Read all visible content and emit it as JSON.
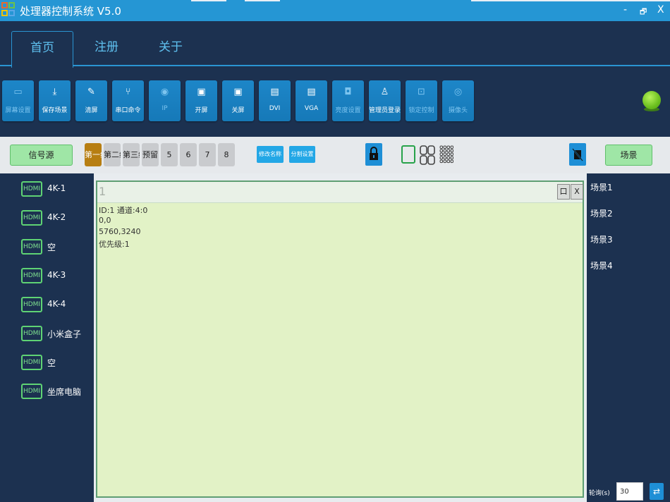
{
  "app": {
    "title": "处理器控制系统 V5.0"
  },
  "window_controls": {
    "minimize": "-",
    "restore": "🗗",
    "close": "X"
  },
  "tabs": [
    {
      "label": "首页",
      "active": true
    },
    {
      "label": "注册",
      "active": false
    },
    {
      "label": "关于",
      "active": false
    }
  ],
  "toolbar": [
    {
      "label": "屏幕设置",
      "icon": "monitor-icon",
      "glyph": "▭",
      "dim": true
    },
    {
      "label": "保存场景",
      "icon": "save-icon",
      "glyph": "⤓",
      "dim": false
    },
    {
      "label": "清屏",
      "icon": "broom-icon",
      "glyph": "✎",
      "dim": false
    },
    {
      "label": "串口命令",
      "icon": "plug-icon",
      "glyph": "⑂",
      "dim": false
    },
    {
      "label": "IP",
      "icon": "ip-icon",
      "glyph": "◉",
      "dim": true
    },
    {
      "label": "开屏",
      "icon": "screen-on-icon",
      "glyph": "▣",
      "dim": false
    },
    {
      "label": "关屏",
      "icon": "screen-off-icon",
      "glyph": "▣",
      "dim": false
    },
    {
      "label": "DVI",
      "icon": "dvi-icon",
      "glyph": "▤",
      "dim": false
    },
    {
      "label": "VGA",
      "icon": "vga-icon",
      "glyph": "▤",
      "dim": false
    },
    {
      "label": "亮度设置",
      "icon": "brightness-icon",
      "glyph": "◘",
      "dim": true
    },
    {
      "label": "管理员登录",
      "icon": "user-icon",
      "glyph": "♙",
      "dim": false
    },
    {
      "label": "锁定控制",
      "icon": "lock-icon",
      "glyph": "⊡",
      "dim": true
    },
    {
      "label": "摄像头",
      "icon": "camera-icon",
      "glyph": "◎",
      "dim": true
    }
  ],
  "controlbar": {
    "source_button": "信号源",
    "scene_button": "场景",
    "pages": [
      {
        "label": "第一组",
        "active": true
      },
      {
        "label": "第二组",
        "active": false
      },
      {
        "label": "第三组",
        "active": false
      },
      {
        "label": "预留",
        "active": false
      },
      {
        "label": "5",
        "active": false
      },
      {
        "label": "6",
        "active": false
      },
      {
        "label": "7",
        "active": false
      },
      {
        "label": "8",
        "active": false
      }
    ],
    "rename_button": "修改名称",
    "split_button": "分割设置"
  },
  "sources": [
    {
      "tag": "HDMI",
      "name": "4K-1"
    },
    {
      "tag": "HDMI",
      "name": "4K-2"
    },
    {
      "tag": "HDMI",
      "name": "空"
    },
    {
      "tag": "HDMI",
      "name": "4K-3"
    },
    {
      "tag": "HDMI",
      "name": "4K-4"
    },
    {
      "tag": "HDMI",
      "name": "小米盒子"
    },
    {
      "tag": "HDMI",
      "name": "空"
    },
    {
      "tag": "HDMI",
      "name": "坐席电脑"
    }
  ],
  "window": {
    "number": "1",
    "pin_button": "口",
    "close_button": "X",
    "info": [
      "ID:1  通道:4:0",
      "0,0",
      "5760,3240",
      "优先级:1"
    ]
  },
  "scenes": [
    "场景1",
    "场景2",
    "场景3",
    "场景4"
  ],
  "polling": {
    "label": "轮询(s)",
    "value": "30"
  },
  "colors": {
    "titlebar": "#2596d4",
    "background": "#1c3150",
    "accent": "#2a95d2",
    "window_fill": "#e2f2c6",
    "status_online": "#8ee03a"
  }
}
